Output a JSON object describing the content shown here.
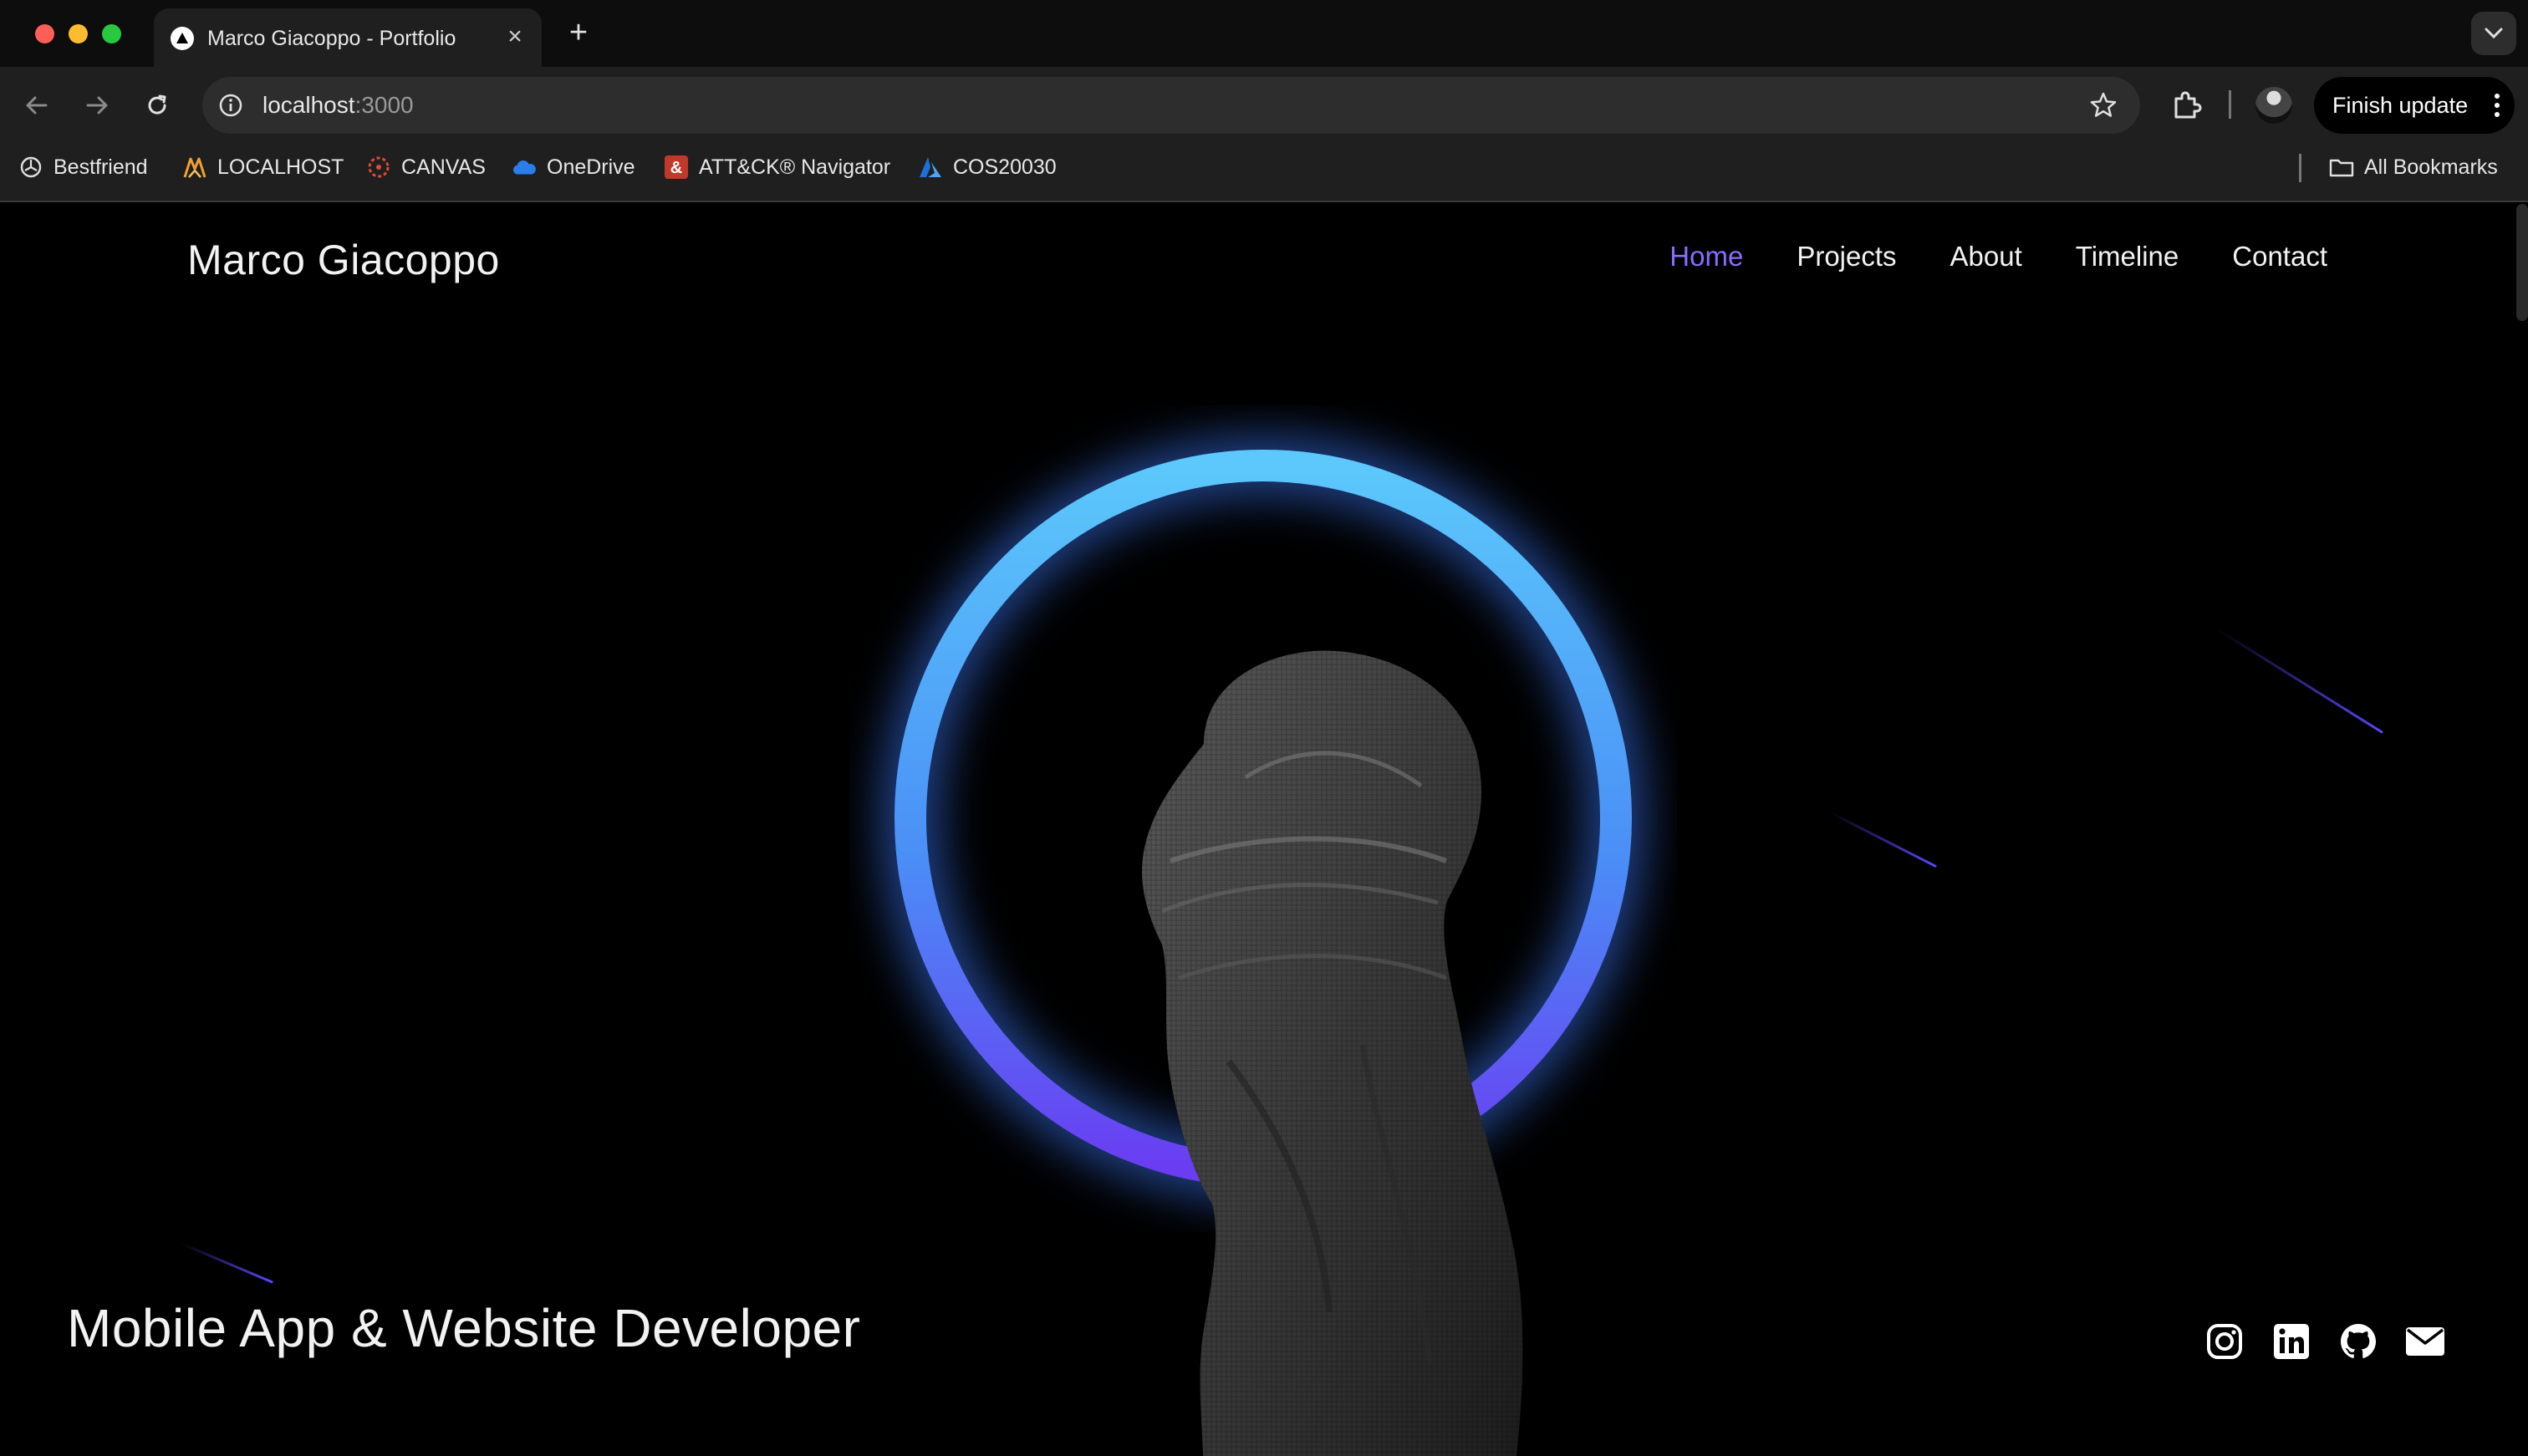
{
  "browser": {
    "tab_title": "Marco Giacoppo - Portfolio",
    "close_glyph": "×",
    "new_tab_glyph": "+",
    "url_host": "localhost",
    "url_port": ":3000",
    "finish_update_label": "Finish update",
    "bookmarks": [
      {
        "label": "Bestfriend",
        "icon": "openai-icon"
      },
      {
        "label": "LOCALHOST",
        "icon": "xampp-icon"
      },
      {
        "label": "CANVAS",
        "icon": "canvas-icon"
      },
      {
        "label": "OneDrive",
        "icon": "onedrive-icon"
      },
      {
        "label": "ATT&CK® Navigator",
        "icon": "attack-icon"
      },
      {
        "label": "COS20030",
        "icon": "azure-icon"
      }
    ],
    "all_bookmarks_label": "All Bookmarks"
  },
  "site": {
    "brand": "Marco Giacoppo",
    "nav": [
      {
        "label": "Home",
        "active": true
      },
      {
        "label": "Projects",
        "active": false
      },
      {
        "label": "About",
        "active": false
      },
      {
        "label": "Timeline",
        "active": false
      },
      {
        "label": "Contact",
        "active": false
      }
    ],
    "tagline": "Mobile App & Website Developer",
    "socials": [
      "instagram-icon",
      "linkedin-icon",
      "github-icon",
      "email-icon"
    ]
  },
  "colors": {
    "accent_nav": "#8a6cff",
    "halo_top": "#5cc8fb",
    "halo_bottom": "#6a3cf2",
    "meteor": "#5a48ff",
    "traffic_red": "#ff5f57",
    "traffic_yellow": "#febc2e",
    "traffic_green": "#28c840"
  }
}
